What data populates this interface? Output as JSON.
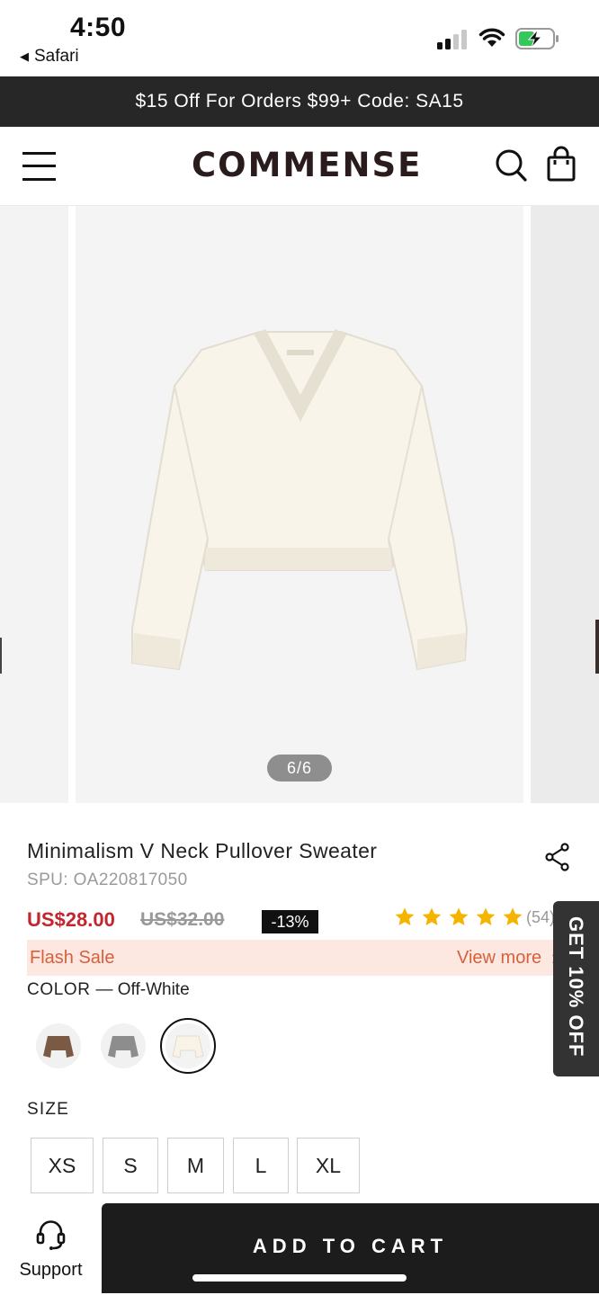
{
  "status_bar": {
    "time": "4:50",
    "back_app": "Safari"
  },
  "promo": {
    "text": "$15 Off For Orders $99+ Code: SA15"
  },
  "header": {
    "logo": "COMMENSE"
  },
  "gallery": {
    "pager": "6/6"
  },
  "product": {
    "title": "Minimalism V Neck Pullover Sweater",
    "spu": "SPU: OA220817050",
    "price": "US$28.00",
    "original_price": "US$32.00",
    "discount": "-13%",
    "rating": 5,
    "reviews": "(54)",
    "flash_label": "Flash Sale",
    "flash_more": "View more",
    "color_label": "COLOR",
    "color_selected": "— Off-White",
    "colors": [
      "brown",
      "grey",
      "off-white"
    ],
    "size_label": "SIZE",
    "sizes": [
      "XS",
      "S",
      "M",
      "L",
      "XL"
    ]
  },
  "side_tab": {
    "label": "GET 10% OFF"
  },
  "bottom": {
    "support_label": "Support",
    "cart_label": "ADD TO CART"
  },
  "colors": {
    "price_red": "#c3262d",
    "flash_bg": "#fde8e1",
    "flash_text": "#d7603b",
    "star": "#f5b400",
    "dark": "#1c1c1c"
  }
}
